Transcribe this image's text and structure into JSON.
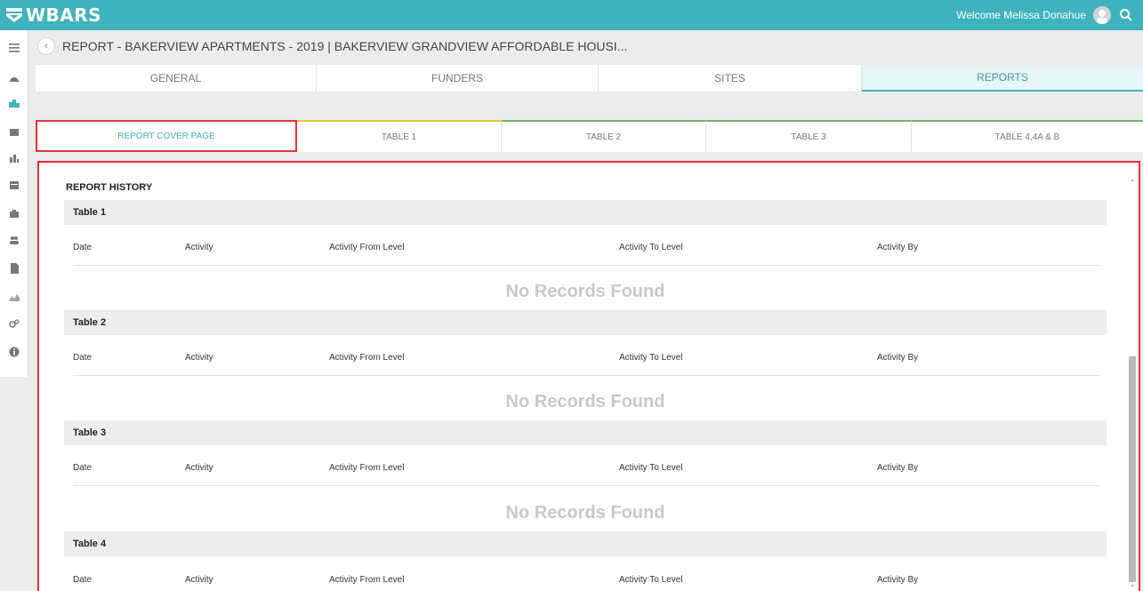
{
  "app": {
    "logo_text": "WBARS",
    "welcome": "Welcome Melissa Donahue",
    "brand_color": "#3fb3bd"
  },
  "sidebar": {
    "items": [
      {
        "icon": "menu-icon"
      },
      {
        "icon": "dashboard-icon"
      },
      {
        "icon": "projects-icon",
        "active": true
      },
      {
        "icon": "building-icon"
      },
      {
        "icon": "reports-chart-icon"
      },
      {
        "icon": "calendar-icon"
      },
      {
        "icon": "briefcase-icon"
      },
      {
        "icon": "users-icon"
      },
      {
        "icon": "document-icon"
      },
      {
        "icon": "area-chart-icon"
      },
      {
        "icon": "settings-icon"
      },
      {
        "icon": "info-icon"
      }
    ]
  },
  "page": {
    "title": "REPORT - BAKERVIEW APARTMENTS - 2019 | BAKERVIEW GRANDVIEW AFFORDABLE HOUSI..."
  },
  "tabs": [
    {
      "label": "GENERAL",
      "active": false
    },
    {
      "label": "FUNDERS",
      "active": false
    },
    {
      "label": "SITES",
      "active": false
    },
    {
      "label": "REPORTS",
      "active": true
    }
  ],
  "subtabs": [
    {
      "label": "REPORT COVER PAGE",
      "active": true
    },
    {
      "label": "TABLE 1"
    },
    {
      "label": "TABLE 2"
    },
    {
      "label": "TABLE 3"
    },
    {
      "label": "TABLE 4,4A & B"
    }
  ],
  "history": {
    "title": "REPORT HISTORY",
    "columns": [
      "Date",
      "Activity",
      "Activity From Level",
      "Activity To Level",
      "Activity By"
    ],
    "empty_text": "No Records Found",
    "sections": [
      {
        "name": "Table 1"
      },
      {
        "name": "Table 2"
      },
      {
        "name": "Table 3"
      },
      {
        "name": "Table 4"
      }
    ]
  }
}
